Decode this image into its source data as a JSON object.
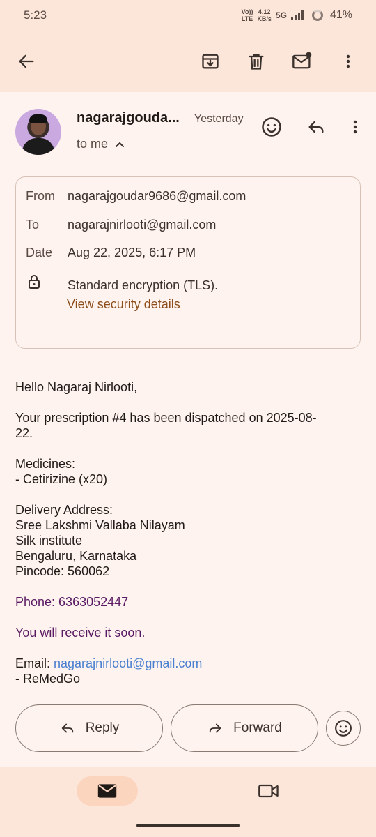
{
  "status_bar": {
    "time": "5:23",
    "volte_top": "Vo))",
    "volte_bottom": "LTE",
    "speed_top": "4.12",
    "speed_bottom": "KB/s",
    "network": "5G",
    "battery": "41%"
  },
  "toolbar": {
    "icons": [
      "back-arrow-icon",
      "archive-icon",
      "delete-icon",
      "mark-unread-icon",
      "more-vert-icon"
    ]
  },
  "message": {
    "sender_name": "nagarajgouda...",
    "time": "Yesterday",
    "to_line": "to me"
  },
  "details": {
    "from_label": "From",
    "from_value": "nagarajgoudar9686@gmail.com",
    "to_label": "To",
    "to_value": "nagarajnirlooti@gmail.com",
    "date_label": "Date",
    "date_value": "Aug 22, 2025, 6:17 PM",
    "encryption": "Standard encryption (TLS).",
    "security_link": "View security details"
  },
  "body": {
    "greeting": "Hello Nagaraj Nirlooti,",
    "dispatch_line1": "Your prescription #4 has been dispatched on 2025-08-",
    "dispatch_line2": "22.",
    "medicines_label": "Medicines:",
    "medicine_1": "- Cetirizine (x20)",
    "address_label": "Delivery Address:",
    "address_1": "Sree Lakshmi Vallaba Nilayam",
    "address_2": "Silk institute",
    "address_3": "Bengaluru, Karnataka",
    "pincode": "Pincode: 560062",
    "phone": "Phone: 6363052447",
    "receive": "You will receive it soon.",
    "email_label": "Email: ",
    "email_link": "nagarajnirlooti@gmail.com",
    "signature": "- ReMedGo"
  },
  "actions": {
    "reply_label": "Reply",
    "forward_label": "Forward"
  },
  "colors": {
    "background": "#fef3ee",
    "bar": "#fce6da",
    "link_brown": "#8d4d1a",
    "purple_text": "#5a1a63",
    "email_link": "#4a7fd0"
  }
}
